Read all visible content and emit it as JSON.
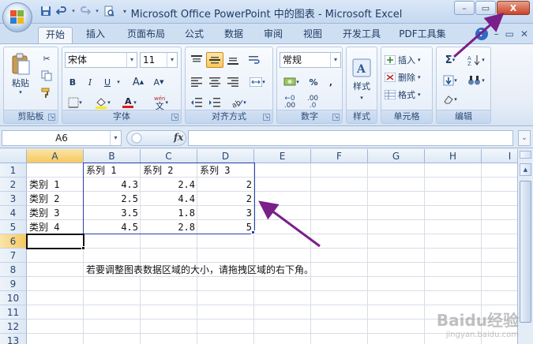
{
  "window": {
    "title": "Microsoft Office PowerPoint 中的图表 - Microsoft Excel",
    "controls": {
      "minimize": "–",
      "restore": "▭",
      "close": "X"
    }
  },
  "qat": [
    "save-icon",
    "undo-icon",
    "redo-icon",
    "print-preview-icon",
    "qat-dropdown-icon"
  ],
  "tabs": [
    {
      "label": "开始",
      "active": true
    },
    {
      "label": "插入"
    },
    {
      "label": "页面布局"
    },
    {
      "label": "公式"
    },
    {
      "label": "数据"
    },
    {
      "label": "审阅"
    },
    {
      "label": "视图"
    },
    {
      "label": "开发工具"
    },
    {
      "label": "PDF工具集"
    }
  ],
  "ribbon": {
    "clipboard": {
      "label": "剪贴板",
      "paste": "粘贴"
    },
    "font": {
      "label": "字体",
      "font_name": "宋体",
      "font_size": "11",
      "bold": "B",
      "italic": "I",
      "underline": "U",
      "grow": "A",
      "shrink": "A",
      "font_color_glyph": "A",
      "phonetic": "wén"
    },
    "alignment": {
      "label": "对齐方式"
    },
    "number": {
      "label": "数字",
      "format": "常规",
      "percent": "%",
      "comma": ",",
      "inc_decimal": ".00",
      "dec_decimal": ".0"
    },
    "styles": {
      "label": "样式",
      "button": "样式"
    },
    "cells": {
      "label": "单元格",
      "insert": "插入",
      "delete": "删除",
      "format": "格式"
    },
    "editing": {
      "label": "编辑",
      "sum": "Σ"
    }
  },
  "formula_bar": {
    "name_box": "A6",
    "fx": "fx",
    "content": ""
  },
  "sheet": {
    "columns": [
      "A",
      "B",
      "C",
      "D",
      "E",
      "F",
      "G",
      "H",
      "I"
    ],
    "selected_column": "A",
    "selected_row": "6",
    "rows": [
      "1",
      "2",
      "3",
      "4",
      "5",
      "6",
      "7",
      "8",
      "9",
      "10",
      "11",
      "12",
      "13"
    ],
    "headers": [
      "系列 1",
      "系列 2",
      "系列 3"
    ],
    "categories": [
      "类别 1",
      "类别 2",
      "类别 3",
      "类别 4"
    ],
    "values": [
      [
        "4.3",
        "2.4",
        "2"
      ],
      [
        "2.5",
        "4.4",
        "2"
      ],
      [
        "3.5",
        "1.8",
        "3"
      ],
      [
        "4.5",
        "2.8",
        "5"
      ]
    ],
    "note": "若要调整图表数据区域的大小，请拖拽区域的右下角。"
  },
  "watermark": {
    "brand": "Baidu经验",
    "url": "jingyan.baidu.com"
  },
  "colors": {
    "annotation_arrow": "#7a1f8a",
    "range_border": "#2a3fb0",
    "selection": "#f7c95e"
  }
}
